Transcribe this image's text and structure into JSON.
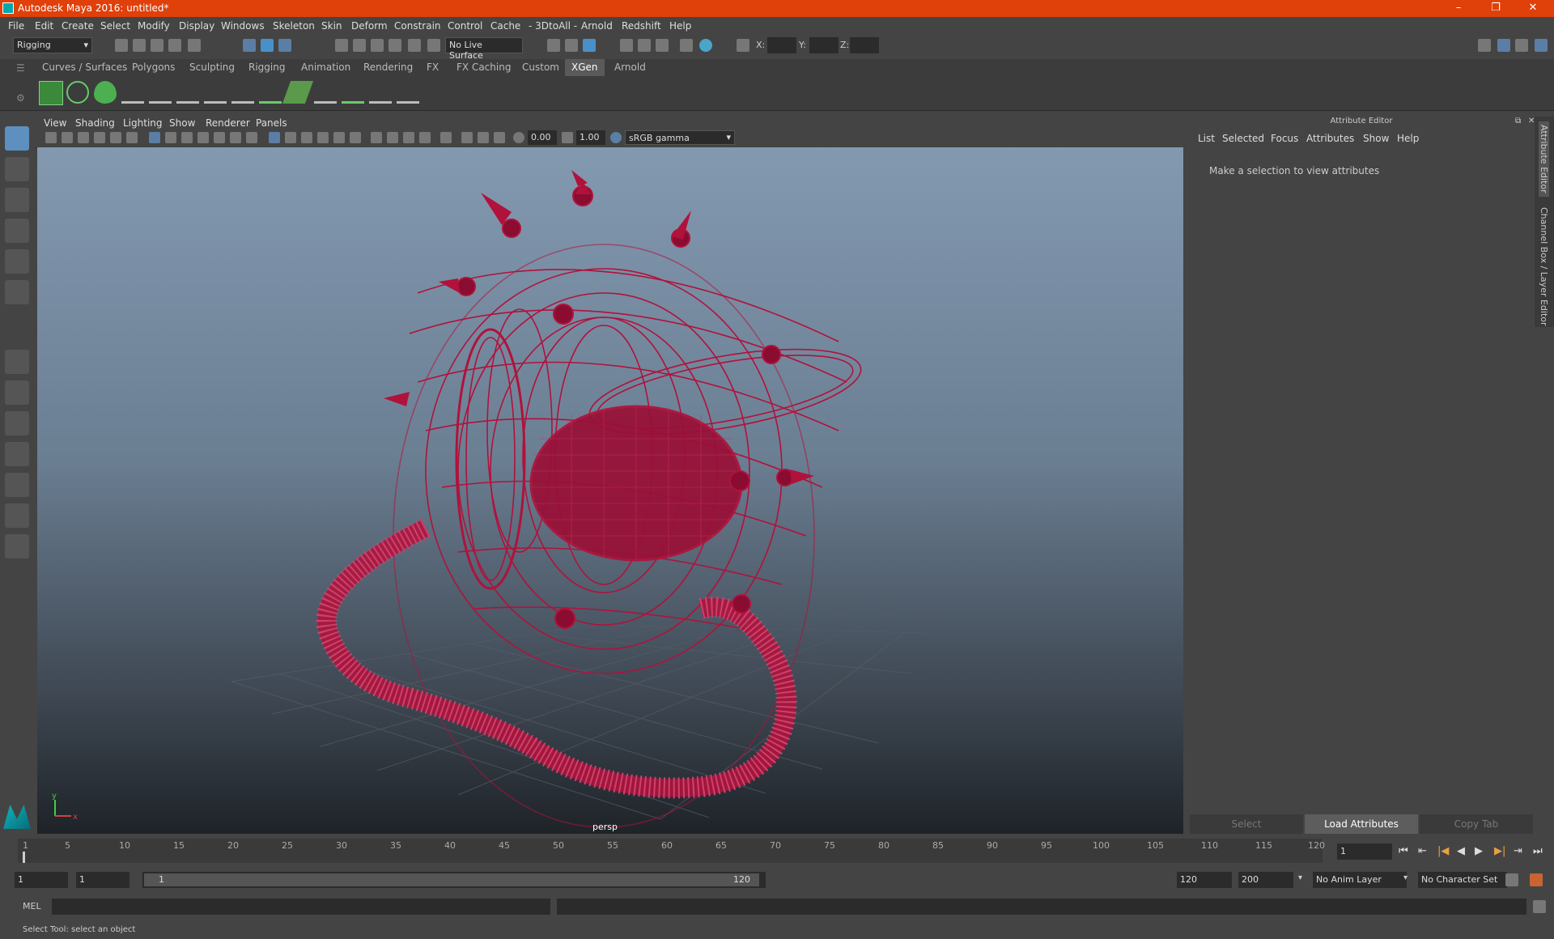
{
  "app": {
    "title": "Autodesk Maya 2016: untitled*"
  },
  "window_controls": {
    "minimize": "–",
    "maximize": "❐",
    "close": "✕"
  },
  "menubar": [
    "File",
    "Edit",
    "Create",
    "Select",
    "Modify",
    "Display",
    "Windows",
    "Skeleton",
    "Skin",
    "Deform",
    "Constrain",
    "Control",
    "Cache",
    "- 3DtoAll -",
    "Arnold",
    "Redshift",
    "Help"
  ],
  "toolbar": {
    "mode": "Rigging",
    "live_surface": "No Live Surface",
    "x_label": "X:",
    "y_label": "Y:",
    "z_label": "Z:"
  },
  "shelf": {
    "tabs": [
      "Curves / Surfaces",
      "Polygons",
      "Sculpting",
      "Rigging",
      "Animation",
      "Rendering",
      "FX",
      "FX Caching",
      "Custom",
      "XGen",
      "Arnold"
    ],
    "active": "XGen"
  },
  "viewport": {
    "menu": [
      "View",
      "Shading",
      "Lighting",
      "Show",
      "Renderer",
      "Panels"
    ],
    "exposure": "0.00",
    "gamma": "1.00",
    "colorspace": "sRGB gamma",
    "camera": "persp",
    "axis_y": "y",
    "axis_x": "x"
  },
  "attribute_editor": {
    "title": "Attribute Editor",
    "menu": [
      "List",
      "Selected",
      "Focus",
      "Attributes",
      "Show",
      "Help"
    ],
    "message": "Make a selection to view attributes",
    "buttons": {
      "select": "Select",
      "load": "Load Attributes",
      "copy": "Copy Tab"
    }
  },
  "side_tabs": {
    "attr": "Attribute Editor",
    "channel": "Channel Box / Layer Editor"
  },
  "timeline": {
    "ticks": [
      "1",
      "5",
      "10",
      "15",
      "20",
      "25",
      "30",
      "35",
      "40",
      "45",
      "50",
      "55",
      "60",
      "65",
      "70",
      "75",
      "80",
      "85",
      "90",
      "95",
      "100",
      "105",
      "110",
      "115",
      "120"
    ],
    "current_frame": "1"
  },
  "range": {
    "start": "1",
    "playback_start": "1",
    "slider_start": "1",
    "slider_end": "120",
    "playback_end": "120",
    "end": "200",
    "anim_layer": "No Anim Layer",
    "char_set": "No Character Set"
  },
  "cmd": {
    "lang": "MEL"
  },
  "status": {
    "message": "Select Tool: select an object"
  },
  "colors": {
    "titlebar": "#e0400a",
    "wireframe": "#b0123c",
    "accent": "#5d8fbf"
  }
}
